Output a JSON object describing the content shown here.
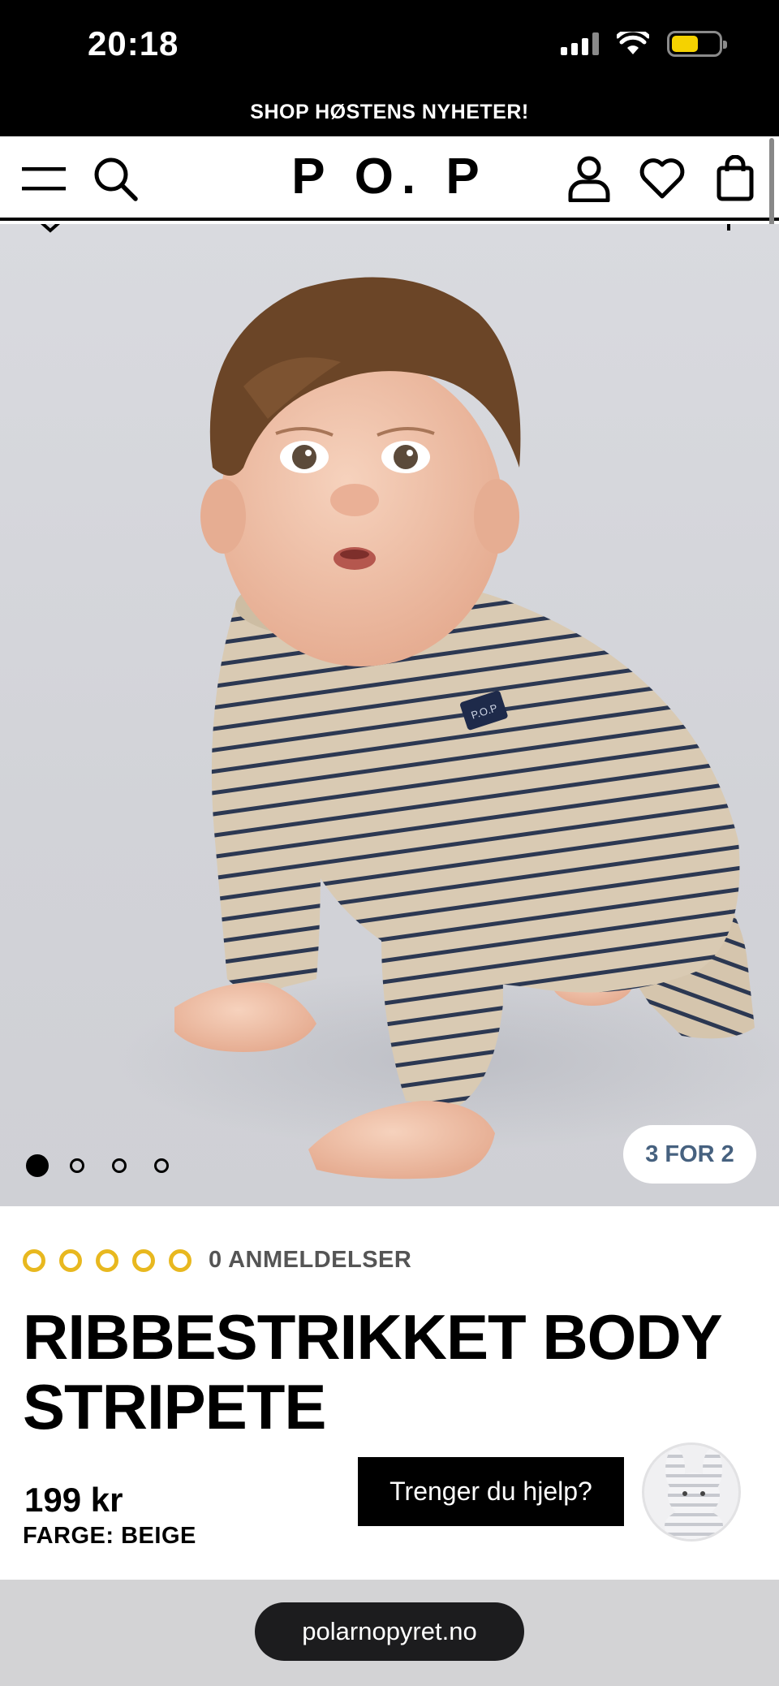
{
  "status_bar": {
    "time": "20:18",
    "battery_level": 0.55
  },
  "promo_banner": {
    "text": "SHOP HØSTENS NYHETER!"
  },
  "header": {
    "logo": "P O. P",
    "icons": [
      "menu-icon",
      "search-icon",
      "account-icon",
      "heart-icon",
      "shopping-bag-icon"
    ]
  },
  "gallery": {
    "slides_total": 4,
    "current_slide": 1,
    "promo_badge": "3 FOR 2"
  },
  "product": {
    "rating_stars": 0,
    "reviews_label": "0 ANMELDELSER",
    "title_line1": "RIBBESTRIKKET BODY",
    "title_line2": "STRIPETE",
    "price": "199 kr",
    "color_label": "FARGE: BEIGE"
  },
  "chat": {
    "help_label": "Trenger du hjelp?"
  },
  "browser": {
    "url": "polarnopyret.no"
  },
  "colors": {
    "accent_star": "#e8b81f",
    "promo_text": "#46617f",
    "stripe": "#2c3852",
    "fabric": "#d9cab3"
  }
}
